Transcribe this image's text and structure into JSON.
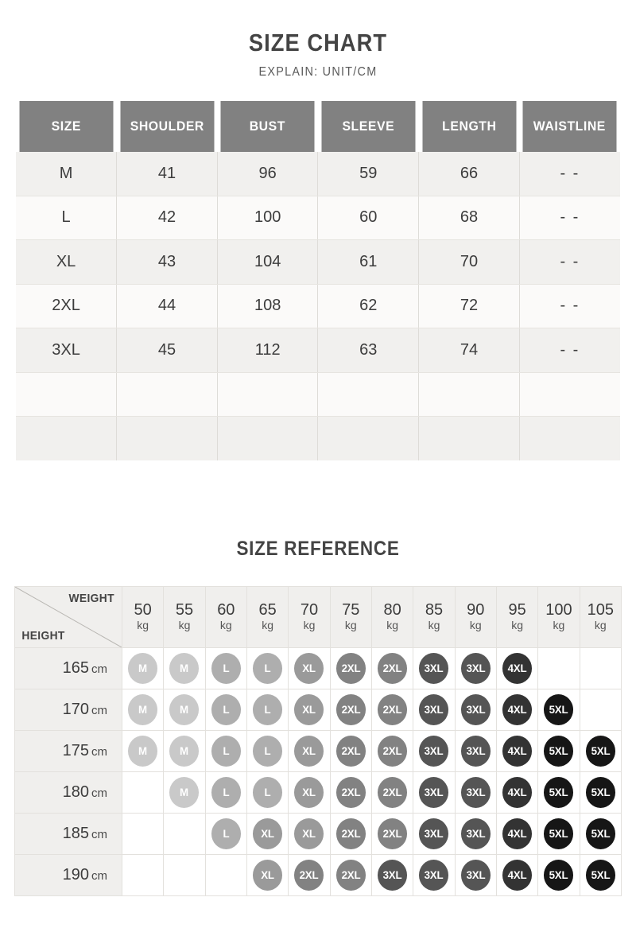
{
  "size_chart": {
    "title": "SIZE CHART",
    "subtitle": "EXPLAIN: UNIT/CM",
    "columns": [
      "SIZE",
      "SHOULDER",
      "BUST",
      "SLEEVE",
      "LENGTH",
      "WAISTLINE"
    ],
    "rows": [
      [
        "M",
        "41",
        "96",
        "59",
        "66",
        "- -"
      ],
      [
        "L",
        "42",
        "100",
        "60",
        "68",
        "- -"
      ],
      [
        "XL",
        "43",
        "104",
        "61",
        "70",
        "- -"
      ],
      [
        "2XL",
        "44",
        "108",
        "62",
        "72",
        "- -"
      ],
      [
        "3XL",
        "45",
        "112",
        "63",
        "74",
        "- -"
      ],
      [
        "",
        "",
        "",
        "",
        "",
        ""
      ],
      [
        "",
        "",
        "",
        "",
        "",
        ""
      ]
    ]
  },
  "size_reference": {
    "title": "SIZE REFERENCE",
    "corner": {
      "weight_label": "WEIGHT",
      "height_label": "HEIGHT"
    },
    "weight_unit": "kg",
    "height_unit": "cm",
    "weights": [
      "50",
      "55",
      "60",
      "65",
      "70",
      "75",
      "80",
      "85",
      "90",
      "95",
      "100",
      "105"
    ],
    "heights": [
      "165",
      "170",
      "175",
      "180",
      "185",
      "190"
    ],
    "grid": [
      [
        "M",
        "M",
        "L",
        "L",
        "XL",
        "2XL",
        "2XL",
        "3XL",
        "3XL",
        "4XL",
        "",
        ""
      ],
      [
        "M",
        "M",
        "L",
        "L",
        "XL",
        "2XL",
        "2XL",
        "3XL",
        "3XL",
        "4XL",
        "5XL",
        ""
      ],
      [
        "M",
        "M",
        "L",
        "L",
        "XL",
        "2XL",
        "2XL",
        "3XL",
        "3XL",
        "4XL",
        "5XL",
        "5XL"
      ],
      [
        "",
        "M",
        "L",
        "L",
        "XL",
        "2XL",
        "2XL",
        "3XL",
        "3XL",
        "4XL",
        "5XL",
        "5XL"
      ],
      [
        "",
        "",
        "L",
        "XL",
        "XL",
        "2XL",
        "2XL",
        "3XL",
        "3XL",
        "4XL",
        "5XL",
        "5XL"
      ],
      [
        "",
        "",
        "",
        "XL",
        "2XL",
        "2XL",
        "3XL",
        "3XL",
        "3XL",
        "4XL",
        "5XL",
        "5XL"
      ]
    ]
  },
  "colors": {
    "header_gray": "#818181",
    "row_odd": "#f1f0ee",
    "row_even": "#fbfaf9",
    "badge_M": "#c9c9c9",
    "badge_L": "#aeaeae",
    "badge_XL": "#9a9a9a",
    "badge_2XL": "#828282",
    "badge_3XL": "#555555",
    "badge_4XL": "#333333",
    "badge_5XL": "#161616"
  }
}
